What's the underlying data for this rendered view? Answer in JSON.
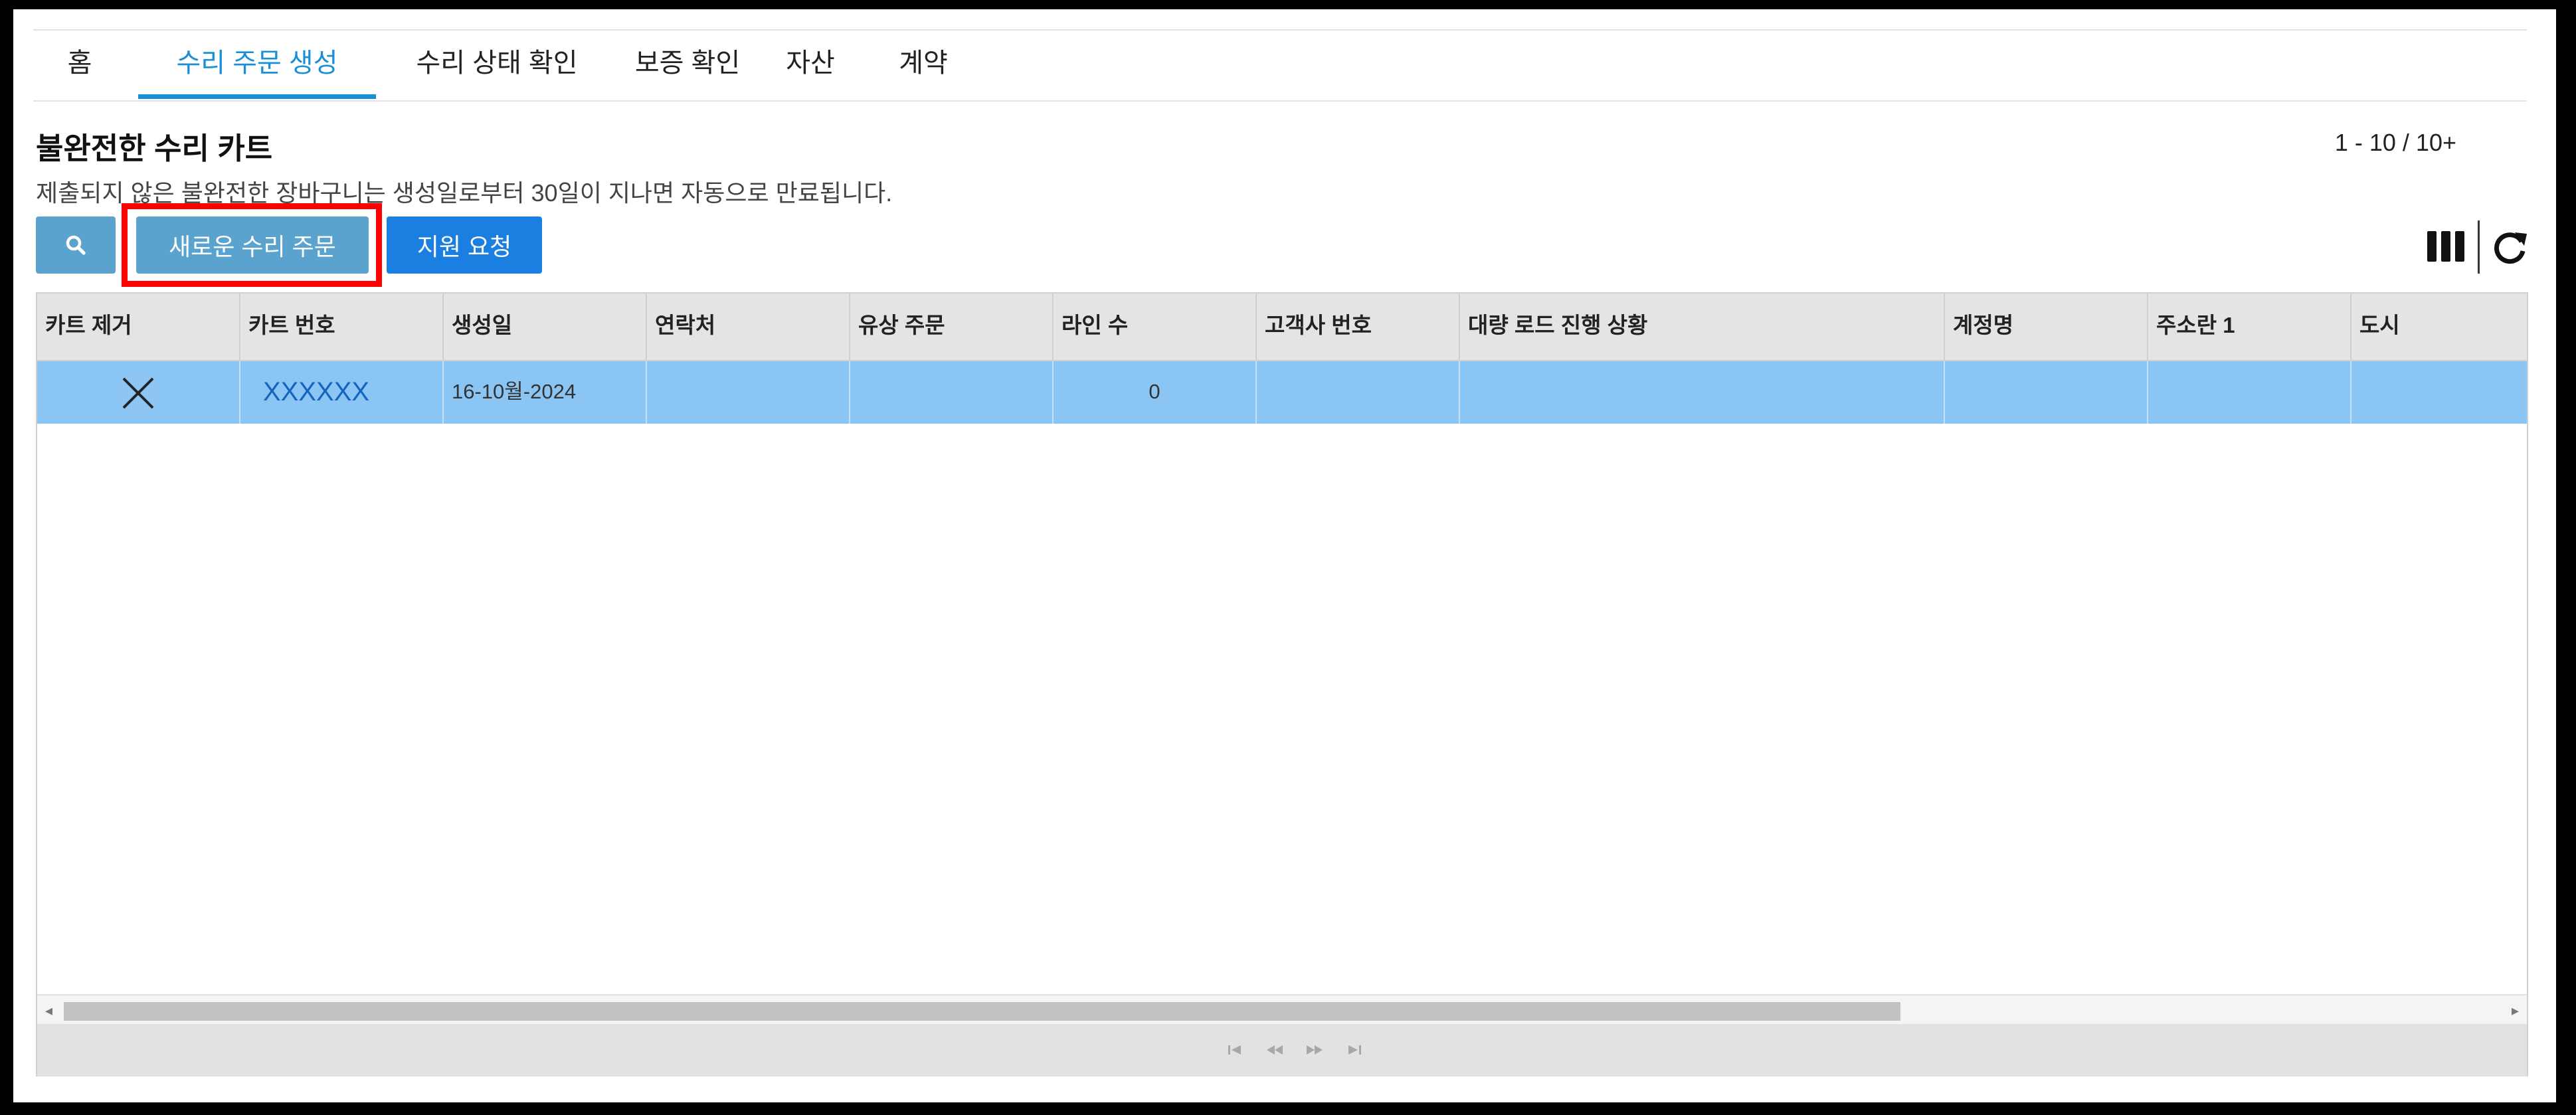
{
  "tabs": [
    {
      "label": "홈"
    },
    {
      "label": "수리 주문 생성"
    },
    {
      "label": "수리 상태 확인"
    },
    {
      "label": "보증 확인"
    },
    {
      "label": "자산"
    },
    {
      "label": "계약"
    }
  ],
  "cart": {
    "title": "불완전한 수리 카트",
    "description": "제출되지 않은 불완전한 장바구니는 생성일로부터 30일이 지나면 자동으로 만료됩니다.",
    "pagination": "1 - 10 / 10+"
  },
  "toolbar": {
    "new_order_label": "새로운 수리 주문",
    "support_label": "지원 요청"
  },
  "grid": {
    "columns": [
      "카트 제거",
      "카트 번호",
      "생성일",
      "연락처",
      "유상 주문",
      "라인 수",
      "고객사 번호",
      "대량 로드 진행 상황",
      "계정명",
      "주소란 1",
      "도시"
    ],
    "rows": [
      {
        "cart_number": "XXXXXX",
        "created": "16-10월-2024",
        "contact": "",
        "paid_order": "",
        "line_count": "0",
        "customer_no": "",
        "bulk_status": "",
        "account": "",
        "address1": "",
        "city": ""
      }
    ]
  },
  "colors": {
    "accent": "#1a8fd6",
    "button": "#5ba3cf",
    "primary_button": "#1a7fe0",
    "selected_row": "#8ac5f3",
    "highlight": "#ff0000"
  }
}
